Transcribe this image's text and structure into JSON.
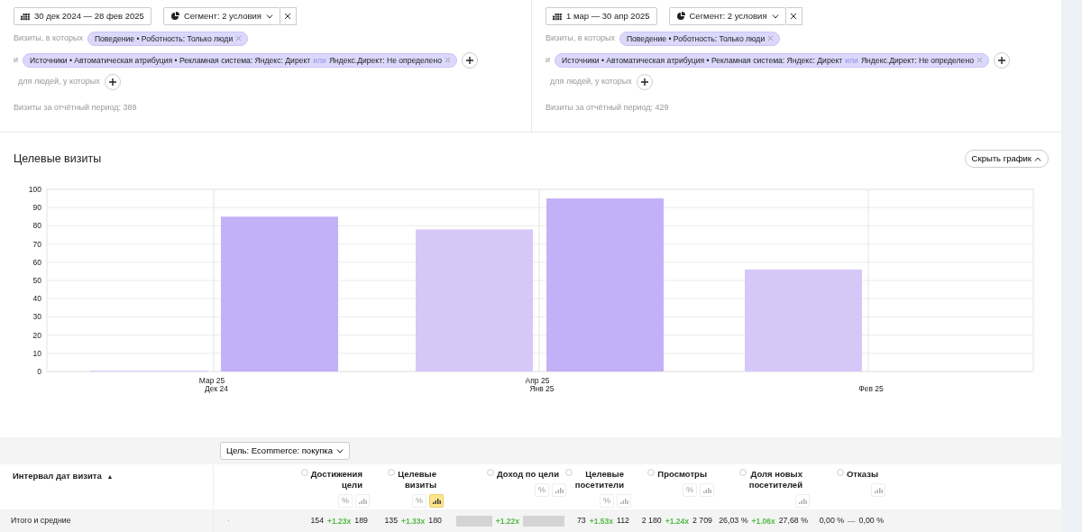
{
  "periods": [
    {
      "date_range": "30 дек 2024 — 28 фев 2025",
      "segment": "Сегмент: 2 условия",
      "conditions": [
        {
          "prefix": "Визиты, в которых",
          "chip": [
            {
              "text": "Поведение • Роботность: Только люди",
              "kind": "value"
            }
          ],
          "add_button": false
        },
        {
          "prefix": "и",
          "chip": [
            {
              "text": "Источники • Автоматическая атрибуция • Рекламная система: Яндекс: Директ",
              "kind": "value"
            },
            {
              "text": "или",
              "kind": "connector"
            },
            {
              "text": "Яндекс.Директ: Не определено",
              "kind": "value"
            }
          ],
          "add_button": true
        },
        {
          "prefix": "для людей, у которых",
          "add_button": true
        }
      ],
      "total": "Визиты за отчётный период: 389"
    },
    {
      "date_range": "1 мар — 30 апр 2025",
      "segment": "Сегмент: 2 условия",
      "conditions": [
        {
          "prefix": "Визиты, в которых",
          "chip": [
            {
              "text": "Поведение • Роботность: Только люди",
              "kind": "value"
            }
          ],
          "add_button": false
        },
        {
          "prefix": "и",
          "chip": [
            {
              "text": "Источники • Автоматическая атрибуция • Рекламная система: Яндекс: Директ",
              "kind": "value"
            },
            {
              "text": "или",
              "kind": "connector"
            },
            {
              "text": "Яндекс.Директ: Не определено",
              "kind": "value"
            }
          ],
          "add_button": true
        },
        {
          "prefix": "для людей, у которых",
          "add_button": true
        }
      ],
      "total": "Визиты за отчётный период: 429"
    }
  ],
  "chart": {
    "title": "Целевые визиты",
    "hide_button": "Скрыть график",
    "chart_data": {
      "type": "bar",
      "categories": [
        {
          "current": "Мар 25",
          "previous": "Дек 24"
        },
        {
          "current": "Апр 25",
          "previous": "Янв 25"
        },
        {
          "previous": "Фев 25"
        }
      ],
      "series": [
        {
          "color": "#d8cbf8",
          "values": [
            0.5,
            78,
            56
          ]
        },
        {
          "color": "#c4b0f7",
          "values": [
            85,
            95,
            null
          ]
        }
      ],
      "grid": true,
      "ylim": [
        0,
        100
      ],
      "yticks": [
        0,
        10,
        20,
        30,
        40,
        50,
        60,
        70,
        80,
        90,
        100
      ]
    }
  },
  "table": {
    "goal_button": "Цель: Ecommerce: покупка",
    "dimension_header": "Интервал дат визита",
    "sort_mark": "▲",
    "columns": [
      {
        "title": [
          "Достижения",
          "цели"
        ],
        "buttons": [
          {
            "kind": "percent",
            "label": "%",
            "selected": false
          },
          {
            "kind": "chart",
            "selected": false
          }
        ]
      },
      {
        "title": [
          "Целевые",
          "визиты"
        ],
        "buttons": [
          {
            "kind": "percent",
            "label": "%",
            "selected": false
          },
          {
            "kind": "chart",
            "selected": true
          }
        ]
      },
      {
        "title": [
          "Доход по цели"
        ],
        "buttons": [
          {
            "kind": "percent",
            "label": "%",
            "selected": false
          },
          {
            "kind": "chart",
            "selected": false
          }
        ]
      },
      {
        "title": [
          "Целевые",
          "посетители"
        ],
        "buttons": [
          {
            "kind": "percent",
            "label": "%",
            "selected": false
          },
          {
            "kind": "chart",
            "selected": false
          }
        ]
      },
      {
        "title": [
          "Просмотры"
        ],
        "buttons": [
          {
            "kind": "percent",
            "label": "%",
            "selected": false
          },
          {
            "kind": "chart",
            "selected": false
          }
        ]
      },
      {
        "title": [
          "Доля новых",
          "посетителей"
        ],
        "buttons": [
          {
            "kind": "chart",
            "selected": false
          }
        ]
      },
      {
        "title": [
          "Отказы"
        ],
        "buttons": [
          {
            "kind": "chart",
            "selected": false
          }
        ]
      }
    ],
    "total_row": {
      "label": "Итого и средние",
      "marker": "·",
      "cells": [
        {
          "value": "154",
          "ratio": "+1.23x",
          "color": "#55b948",
          "compare": "189"
        },
        {
          "value": "135",
          "ratio": "+1.33x",
          "color": "#55b948",
          "compare": "180"
        },
        {
          "blurred": true,
          "ratio": "+1.22x",
          "color": "#55b948"
        },
        {
          "value": "73",
          "ratio": "+1.53x",
          "color": "#55b948",
          "compare": "112"
        },
        {
          "value": "2 180",
          "ratio": "+1.24x",
          "color": "#55b948",
          "compare": "2 709"
        },
        {
          "value": "26,03 %",
          "ratio": "+1.06x",
          "color": "#55b948",
          "compare": "27,68 %"
        },
        {
          "value": "0,00 %",
          "ratio": "—",
          "color": "#999999",
          "compare": "0,00 %"
        }
      ]
    }
  }
}
